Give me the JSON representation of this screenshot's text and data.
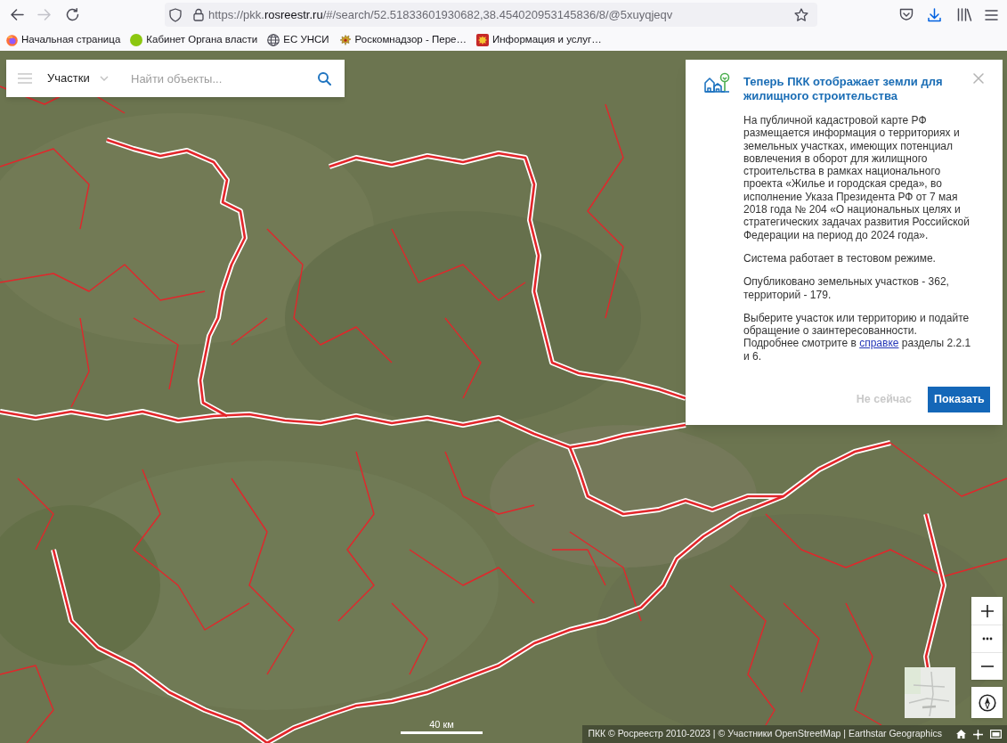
{
  "browser": {
    "navigation": [
      {
        "disabled": false
      },
      {
        "disabled": true
      }
    ],
    "url": {
      "before_domain": "https://pkk.",
      "domain": "rosreestr.ru",
      "after_domain": "/#/search/52.51833601930682,38.454020953145836/8/@5xuyqjeqv"
    }
  },
  "bookmarks": [
    {
      "label": "Начальная страница"
    },
    {
      "label": "Кабинет Органа власти"
    },
    {
      "label": "ЕС УНСИ"
    },
    {
      "label": "Роскомнадзор - Пере…"
    },
    {
      "label": "Информация и услуг…"
    }
  ],
  "search_panel": {
    "layer": "Участки",
    "placeholder": "Найти объекты..."
  },
  "notice": {
    "title": "Теперь ПКК отображает земли для жилищного строительства",
    "paragraphs": [
      {
        "text": "На публичной кадастровой карте РФ размещается информация о территориях и земельных участках, имеющих потенциал вовлечения в оборот для жилищного строительства в рамках национального проекта «Жилье и городская среда», во исполнение Указа Президента РФ от 7 мая 2018 года № 204 «О национальных целях и стратегических задачах развития Российской Федерации на период до 2024 года»."
      },
      {
        "text": "Система работает в тестовом режиме."
      },
      {
        "text": "Опубликовано земельных участков - 362, территорий - 179."
      },
      {
        "text": "Выберите участок или территорию и подайте обращение о заинтересованности.\nПодробнее смотрите в ",
        "link": "справке",
        "text_after": " разделы 2.2.1 и 6."
      }
    ],
    "buttons": [
      {
        "label": "Не сейчас",
        "kind": "secondary"
      },
      {
        "label": "Показать",
        "kind": "primary"
      }
    ]
  },
  "map": {
    "scale": "40 км",
    "attribution": "ПКК © Росреестр 2010-2023 | © Участники OpenStreetMap | Earthstar Geographics"
  }
}
